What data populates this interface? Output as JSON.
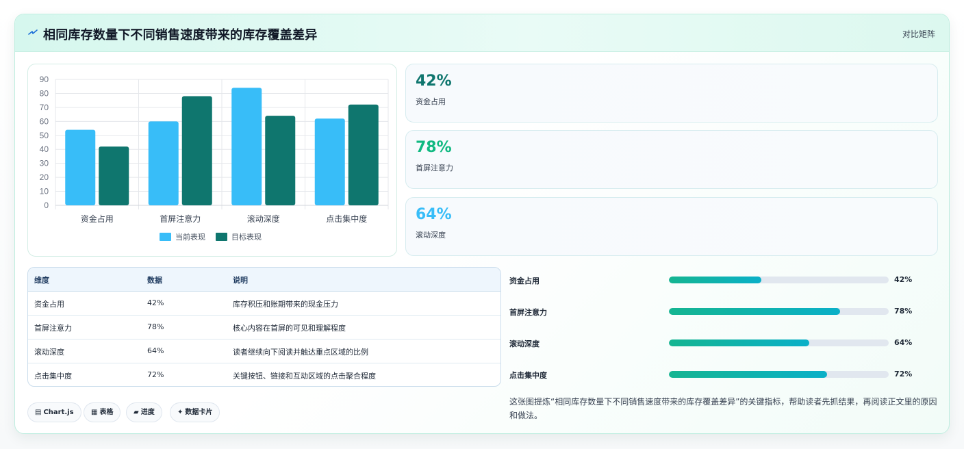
{
  "header": {
    "title": "相同库存数量下不同销售速度带来的库存覆盖差异",
    "tag": "对比矩阵",
    "icon": "lightning-icon"
  },
  "chart_data": {
    "type": "bar",
    "categories": [
      "资金占用",
      "首屏注意力",
      "滚动深度",
      "点击集中度"
    ],
    "series": [
      {
        "name": "当前表现",
        "values": [
          54,
          60,
          84,
          62
        ],
        "color": "#38bdf8"
      },
      {
        "name": "目标表现",
        "values": [
          42,
          78,
          64,
          72
        ],
        "color": "#0f766e"
      }
    ],
    "ylim": [
      0,
      90
    ],
    "yticks": [
      0,
      10,
      20,
      30,
      40,
      50,
      60,
      70,
      80,
      90
    ],
    "grid": true,
    "legend": "bottom"
  },
  "kpis": [
    {
      "value": "42%",
      "label": "资金占用",
      "color": "#0f766e"
    },
    {
      "value": "78%",
      "label": "首屏注意力",
      "color": "#10b981"
    },
    {
      "value": "64%",
      "label": "滚动深度",
      "color": "#38bdf8"
    }
  ],
  "table": {
    "headers": [
      "维度",
      "数据",
      "说明"
    ],
    "rows": [
      [
        "资金占用",
        "42%",
        "库存积压和账期带来的现金压力"
      ],
      [
        "首屏注意力",
        "78%",
        "核心内容在首屏的可见和理解程度"
      ],
      [
        "滚动深度",
        "64%",
        "读者继续向下阅读并触达重点区域的比例"
      ],
      [
        "点击集中度",
        "72%",
        "关键按钮、链接和互动区域的点击聚合程度"
      ]
    ]
  },
  "progress": [
    {
      "label": "资金占用",
      "value": 42,
      "text": "42%"
    },
    {
      "label": "首屏注意力",
      "value": 78,
      "text": "78%"
    },
    {
      "label": "滚动深度",
      "value": 64,
      "text": "64%"
    },
    {
      "label": "点击集中度",
      "value": 72,
      "text": "72%"
    }
  ],
  "note": "这张图提炼“相同库存数量下不同销售速度带来的库存覆盖差异”的关键指标，帮助读者先抓结果，再阅读正文里的原因和做法。",
  "chips": [
    {
      "label": "Chart.js",
      "icon": "chart-icon",
      "glyph": "▤"
    },
    {
      "label": "表格",
      "icon": "table-icon",
      "glyph": "▦"
    },
    {
      "label": "进度",
      "icon": "progress-icon",
      "glyph": "▰"
    },
    {
      "label": "数据卡片",
      "icon": "sparkle-icon",
      "glyph": "✦"
    }
  ]
}
